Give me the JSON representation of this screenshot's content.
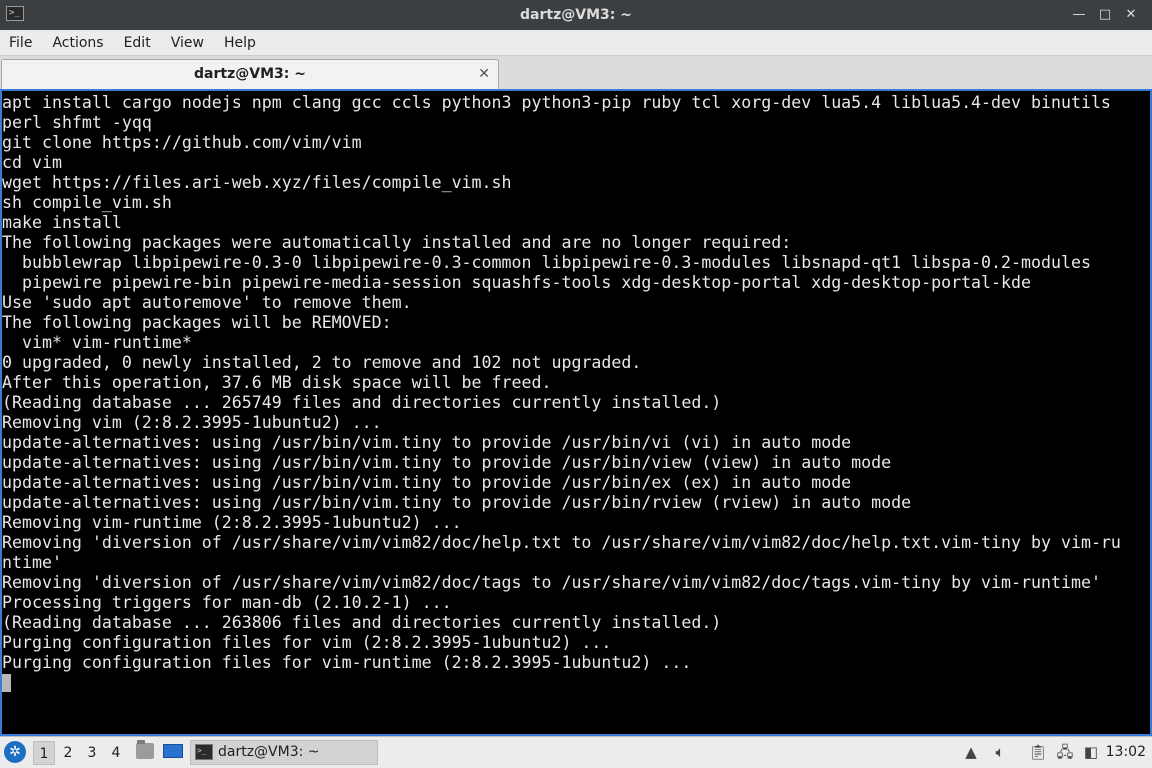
{
  "window": {
    "title": "dartz@VM3: ~",
    "app_icon": "terminal-icon",
    "controls": [
      "minimize",
      "maximize",
      "close"
    ],
    "control_glyphs": [
      "—",
      "□",
      "✕"
    ]
  },
  "menu": [
    "File",
    "Actions",
    "Edit",
    "View",
    "Help"
  ],
  "tab": {
    "label": "dartz@VM3: ~",
    "close_glyph": "✕"
  },
  "terminal": {
    "lines": [
      "apt install cargo nodejs npm clang gcc ccls python3 python3-pip ruby tcl xorg-dev lua5.4 liblua5.4-dev binutils",
      "perl shfmt -yqq",
      "git clone https://github.com/vim/vim",
      "cd vim",
      "wget https://files.ari-web.xyz/files/compile_vim.sh",
      "sh compile_vim.sh",
      "make install",
      "The following packages were automatically installed and are no longer required:",
      "  bubblewrap libpipewire-0.3-0 libpipewire-0.3-common libpipewire-0.3-modules libsnapd-qt1 libspa-0.2-modules",
      "  pipewire pipewire-bin pipewire-media-session squashfs-tools xdg-desktop-portal xdg-desktop-portal-kde",
      "Use 'sudo apt autoremove' to remove them.",
      "The following packages will be REMOVED:",
      "  vim* vim-runtime*",
      "0 upgraded, 0 newly installed, 2 to remove and 102 not upgraded.",
      "After this operation, 37.6 MB disk space will be freed.",
      "(Reading database ... 265749 files and directories currently installed.)",
      "Removing vim (2:8.2.3995-1ubuntu2) ...",
      "update-alternatives: using /usr/bin/vim.tiny to provide /usr/bin/vi (vi) in auto mode",
      "update-alternatives: using /usr/bin/vim.tiny to provide /usr/bin/view (view) in auto mode",
      "update-alternatives: using /usr/bin/vim.tiny to provide /usr/bin/ex (ex) in auto mode",
      "update-alternatives: using /usr/bin/vim.tiny to provide /usr/bin/rview (rview) in auto mode",
      "Removing vim-runtime (2:8.2.3995-1ubuntu2) ...",
      "Removing 'diversion of /usr/share/vim/vim82/doc/help.txt to /usr/share/vim/vim82/doc/help.txt.vim-tiny by vim-ru",
      "ntime'",
      "Removing 'diversion of /usr/share/vim/vim82/doc/tags to /usr/share/vim/vim82/doc/tags.vim-tiny by vim-runtime'",
      "Processing triggers for man-db (2.10.2-1) ...",
      "(Reading database ... 263806 files and directories currently installed.)",
      "Purging configuration files for vim (2:8.2.3995-1ubuntu2) ...",
      "Purging configuration files for vim-runtime (2:8.2.3995-1ubuntu2) ..."
    ],
    "background": "#000000",
    "foreground": "#e8e8e8"
  },
  "taskbar": {
    "start_icon": "start-menu-icon",
    "workspaces": [
      "1",
      "2",
      "3",
      "4"
    ],
    "active_workspace": "1",
    "launchers": [
      "file-manager-icon",
      "show-desktop-icon"
    ],
    "task": {
      "label": "dartz@VM3: ~",
      "icon": "terminal-icon"
    },
    "tray": [
      "up-arrow-icon",
      "volume-icon",
      "clipboard-icon",
      "network-icon",
      "notifications-icon"
    ],
    "clock": "13:02"
  },
  "colors": {
    "accent": "#3a7bd5",
    "titlebar": "#3c3f41",
    "taskbar": "#ececec"
  }
}
